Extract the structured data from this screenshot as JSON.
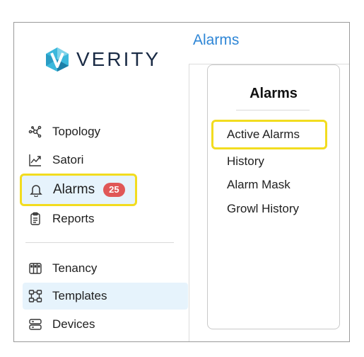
{
  "brand": {
    "name": "VERITY",
    "logo_icon": "verity-hexagon-logo"
  },
  "sidebar": {
    "items": [
      {
        "label": "Topology",
        "icon": "topology-icon"
      },
      {
        "label": "Satori",
        "icon": "chart-trend-icon"
      },
      {
        "label": "Alarms",
        "icon": "bell-icon",
        "badge": "25"
      },
      {
        "label": "Reports",
        "icon": "clipboard-icon"
      },
      {
        "label": "Tenancy",
        "icon": "tenancy-icon"
      },
      {
        "label": "Templates",
        "icon": "templates-icon"
      },
      {
        "label": "Devices",
        "icon": "server-icon"
      }
    ]
  },
  "main": {
    "title": "Alarms",
    "card": {
      "title": "Alarms",
      "items": [
        {
          "label": "Active Alarms"
        },
        {
          "label": "History"
        },
        {
          "label": "Alarm Mask"
        },
        {
          "label": "Growl History"
        }
      ]
    }
  },
  "colors": {
    "accent": "#2e86d6",
    "highlight": "#f2dc1f",
    "badge": "#e05757",
    "active_bg": "#e6f3fc"
  }
}
